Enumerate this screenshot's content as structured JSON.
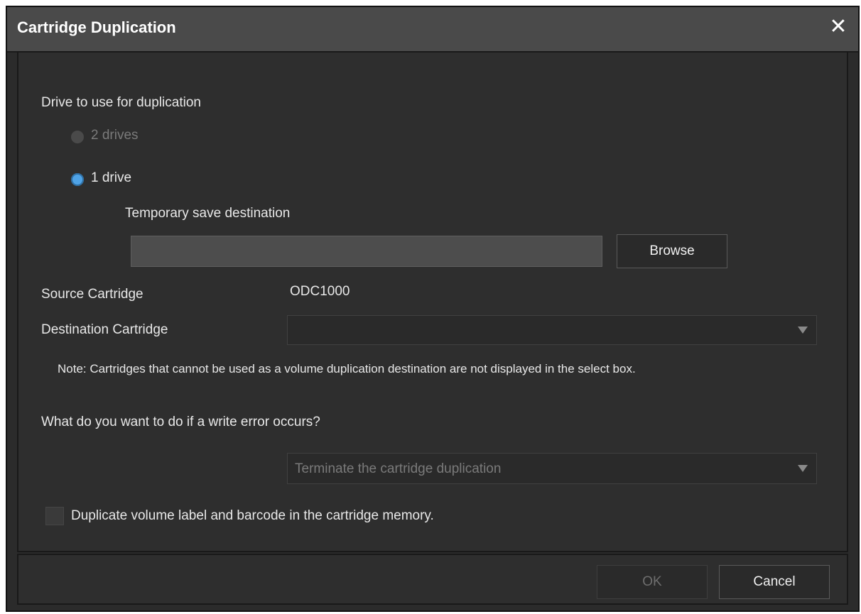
{
  "window": {
    "title": "Cartridge Duplication",
    "close_glyph": "✕"
  },
  "drive_section": {
    "label": "Drive to use for duplication",
    "option_2_drives": "2 drives",
    "option_1_drive": "1 drive",
    "selected": "1 drive",
    "temp_save_label": "Temporary save destination",
    "temp_save_value": "",
    "browse_label": "Browse"
  },
  "source": {
    "label": "Source Cartridge",
    "value": "ODC1000"
  },
  "destination": {
    "label": "Destination Cartridge",
    "selected": ""
  },
  "note": "Note: Cartridges that cannot be used as a volume duplication destination are not displayed in the select box.",
  "write_error": {
    "question": "What do you want to do if a write error occurs?",
    "selected": "Terminate the cartridge duplication"
  },
  "checkbox": {
    "label": "Duplicate volume label and barcode in the cartridge memory.",
    "checked": false
  },
  "footer": {
    "ok_label": "OK",
    "cancel_label": "Cancel"
  },
  "colors": {
    "accent": "#4fa3e6",
    "background": "#2b2b2b",
    "titlebar": "#4a4a4a"
  }
}
